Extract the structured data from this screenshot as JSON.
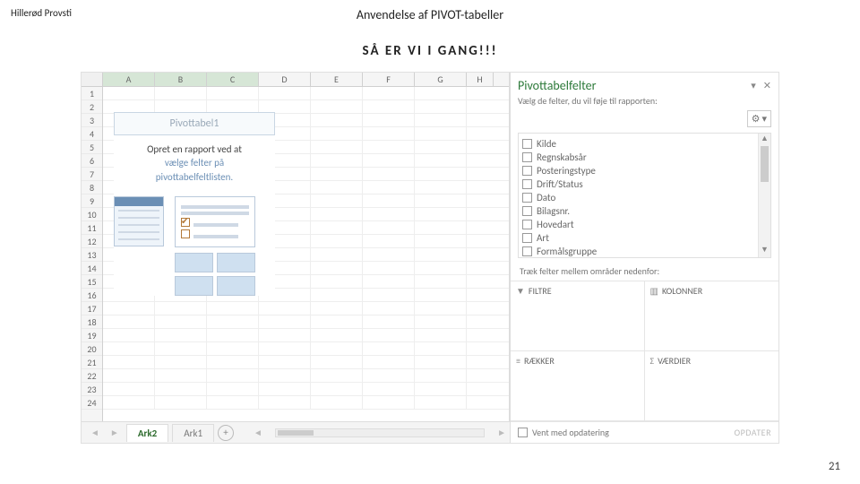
{
  "header": {
    "left": "Hillerød Provsti",
    "title": "Anvendelse af PIVOT-tabeller",
    "subhead": "SÅ ER VI I GANG!!!"
  },
  "page_number": "21",
  "columns": [
    "A",
    "B",
    "C",
    "D",
    "E",
    "F",
    "G",
    "H"
  ],
  "rows": [
    "1",
    "2",
    "3",
    "4",
    "5",
    "6",
    "7",
    "8",
    "9",
    "10",
    "11",
    "12",
    "13",
    "14",
    "15",
    "16",
    "17",
    "18",
    "19",
    "20",
    "21",
    "22",
    "23",
    "24"
  ],
  "pivot_placeholder": {
    "title": "Pivottabel1",
    "line1": "Opret en rapport ved at",
    "line2": "vælge felter på",
    "line3": "pivottabelfeltlisten."
  },
  "sheet_tabs": {
    "active": "Ark2",
    "other": "Ark1",
    "add": "+"
  },
  "pane": {
    "title": "Pivottabelfelter",
    "sub": "Vælg de felter, du vil føje til rapporten:",
    "fields": [
      "Kilde",
      "Regnskabsår",
      "Posteringstype",
      "Drift/Status",
      "Dato",
      "Bilagsnr.",
      "Hovedart",
      "Art",
      "Formålsgruppe"
    ],
    "drag_label": "Træk felter mellem områder nedenfor:",
    "zones": {
      "filters": "FILTRE",
      "columns": "KOLONNER",
      "rows": "RÆKKER",
      "values": "VÆRDIER"
    },
    "defer": "Vent med opdatering",
    "update": "OPDATER"
  }
}
